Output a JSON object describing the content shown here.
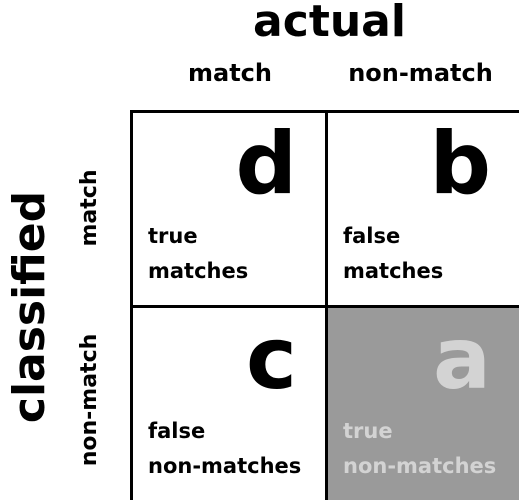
{
  "header": {
    "title": "actual",
    "columns": [
      "match",
      "non-match"
    ]
  },
  "side": {
    "title": "classified",
    "rows": [
      "match",
      "non-match"
    ]
  },
  "cells": [
    {
      "letter": "d",
      "line1": "true",
      "line2": "matches"
    },
    {
      "letter": "b",
      "line1": "false",
      "line2": "matches"
    },
    {
      "letter": "c",
      "line1": "false",
      "line2": "non-matches"
    },
    {
      "letter": "a",
      "line1": "true",
      "line2": "non-matches"
    }
  ],
  "colors": {
    "border": "#000000",
    "highlight_fill": "#9a9a9a",
    "highlight_text": "#d3d3d3"
  }
}
